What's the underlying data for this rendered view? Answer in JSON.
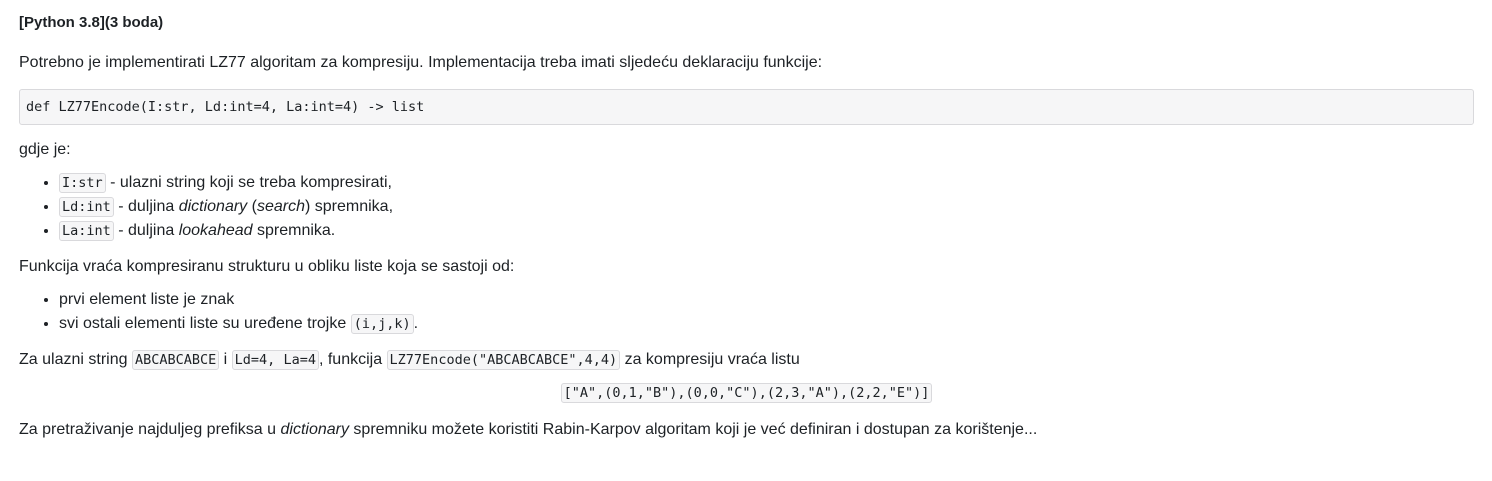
{
  "question": {
    "title": "[Python 3.8](3 boda)",
    "intro": "Potrebno je implementirati LZ77 algoritam za kompresiju. Implementacija treba imati sljedeću deklaraciju funkcije:",
    "code_declaration": "def LZ77Encode(I:str, Ld:int=4, La:int=4) -> list",
    "gdje_je": "gdje je:",
    "params": [
      {
        "code": "I:str",
        "text": " - ulazni string koji se treba kompresirati,"
      },
      {
        "code": "Ld:int",
        "text_before": " - duljina ",
        "em1": "dictionary",
        "text_mid": " (",
        "em2": "search",
        "text_after": ") spremnika,"
      },
      {
        "code": "La:int",
        "text_before": " - duljina ",
        "em1": "lookahead",
        "text_after": " spremnika."
      }
    ],
    "returns_intro": "Funkcija vraća kompresiranu strukturu u obliku liste koja se sastoji od:",
    "returns": [
      {
        "text": "prvi element liste je znak"
      },
      {
        "text": "svi ostali elementi liste su uređene trojke ",
        "code": "(i,j,k)",
        "suffix": "."
      }
    ],
    "example": {
      "t1": "Za ulazni string ",
      "c1": "ABCABCABCE",
      "t2": " i ",
      "c2": "Ld=4, La=4",
      "t3": ", funkcija ",
      "c3": "LZ77Encode(\"ABCABCABCE\",4,4)",
      "t4": " za kompresiju vraća listu"
    },
    "result": "[\"A\",(0,1,\"B\"),(0,0,\"C\"),(2,3,\"A\"),(2,2,\"E\")]",
    "final": {
      "t1": "Za pretraživanje najduljeg prefiksa u ",
      "em": "dictionary",
      "t2": " spremniku možete koristiti Rabin-Karpov algoritam koji je već definiran i dostupan za korištenje..."
    }
  }
}
